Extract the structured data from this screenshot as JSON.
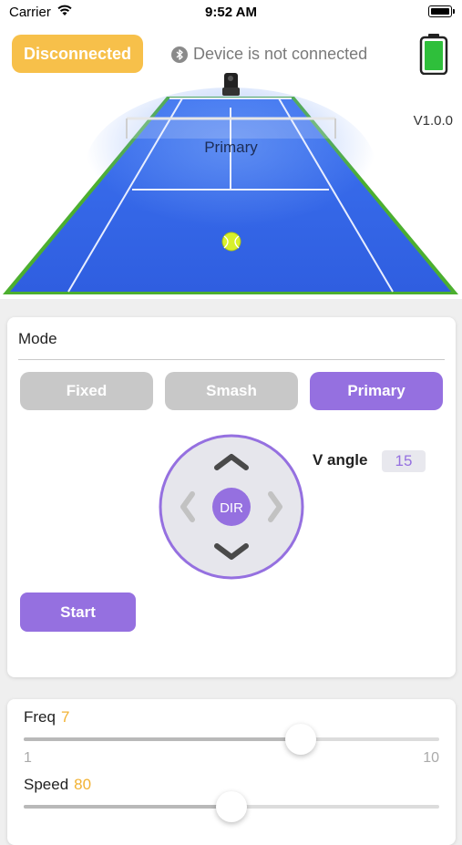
{
  "status_bar": {
    "carrier": "Carrier",
    "time": "9:52 AM"
  },
  "header": {
    "connection_button": "Disconnected",
    "device_status": "Device is not connected",
    "version": "V1.0.0",
    "court_label": "Primary",
    "battery_icon": "battery-full-icon",
    "bluetooth_icon": "bluetooth-icon"
  },
  "mode": {
    "title": "Mode",
    "buttons": [
      {
        "label": "Fixed",
        "active": false
      },
      {
        "label": "Smash",
        "active": false
      },
      {
        "label": "Primary",
        "active": true
      }
    ],
    "dpad_center": "DIR",
    "v_angle_label": "V angle",
    "v_angle_value": "15",
    "start_label": "Start"
  },
  "sliders": {
    "freq": {
      "label": "Freq",
      "value": "7",
      "min": "1",
      "max": "10",
      "fraction": 0.6667
    },
    "speed": {
      "label": "Speed",
      "value": "80",
      "fraction": 0.5
    }
  },
  "colors": {
    "accent": "#9570e0",
    "disconnected": "#f7c04a",
    "court_blue": "#3a63e0",
    "court_border": "#4caf2f",
    "slider_value": "#f2b233",
    "battery": "#2fbf3b"
  }
}
